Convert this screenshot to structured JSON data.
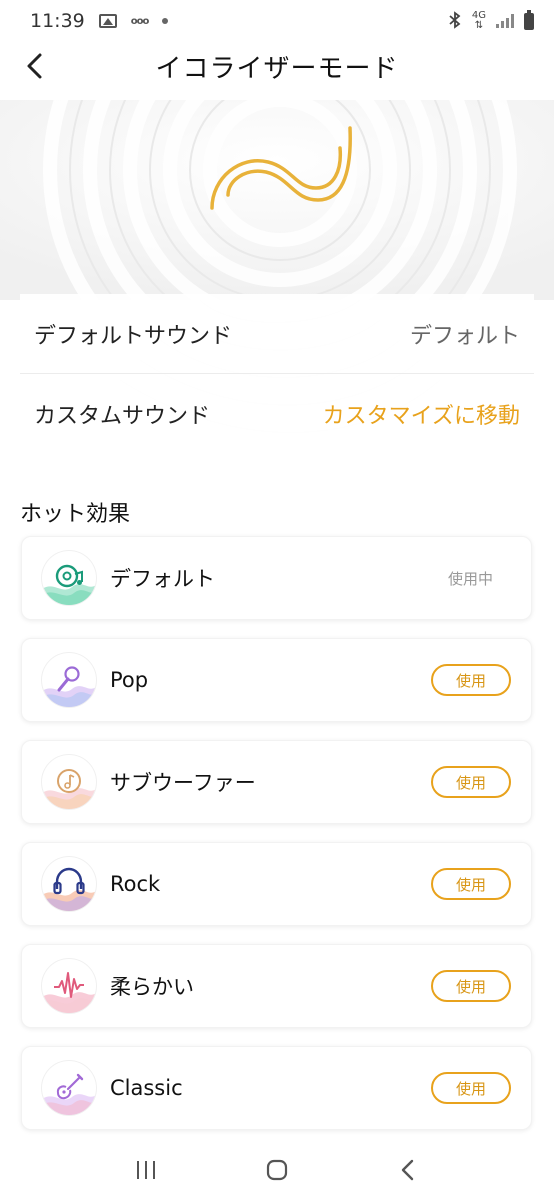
{
  "status_bar": {
    "time": "11:39",
    "tag": "ooo",
    "network": "4G",
    "icons": [
      "gallery-icon",
      "dot-icon",
      "bluetooth-icon",
      "signal-icon",
      "battery-icon"
    ]
  },
  "header": {
    "title": "イコライザーモード",
    "back_icon": "chevron-left-icon"
  },
  "settings": {
    "default_sound": {
      "label": "デフォルトサウンド",
      "value": "デフォルト"
    },
    "custom_sound": {
      "label": "カスタムサウンド",
      "action": "カスタマイズに移動"
    }
  },
  "hot_effects": {
    "title": "ホット効果",
    "items": [
      {
        "name": "デフォルト",
        "status": "使用中",
        "icon": "speaker-music-icon"
      },
      {
        "name": "Pop",
        "button": "使用",
        "icon": "microphone-icon"
      },
      {
        "name": "サブウーファー",
        "button": "使用",
        "icon": "vinyl-note-icon"
      },
      {
        "name": "Rock",
        "button": "使用",
        "icon": "headphones-icon"
      },
      {
        "name": "柔らかい",
        "button": "使用",
        "icon": "waveform-icon"
      },
      {
        "name": "Classic",
        "button": "使用",
        "icon": "guitar-icon"
      }
    ]
  },
  "colors": {
    "accent": "#e8a21c",
    "default_wave": "#6fd6b0",
    "pop_wave": "#c6a6f0",
    "subwoofer_wave": "#f5c0c8",
    "rock_wave": "#f3a07a",
    "soft_wave": "#f3a3b8",
    "classic_wave": "#d8b5f3"
  },
  "nav_bar": {
    "icons": [
      "recent-apps-icon",
      "home-icon",
      "back-icon"
    ]
  }
}
